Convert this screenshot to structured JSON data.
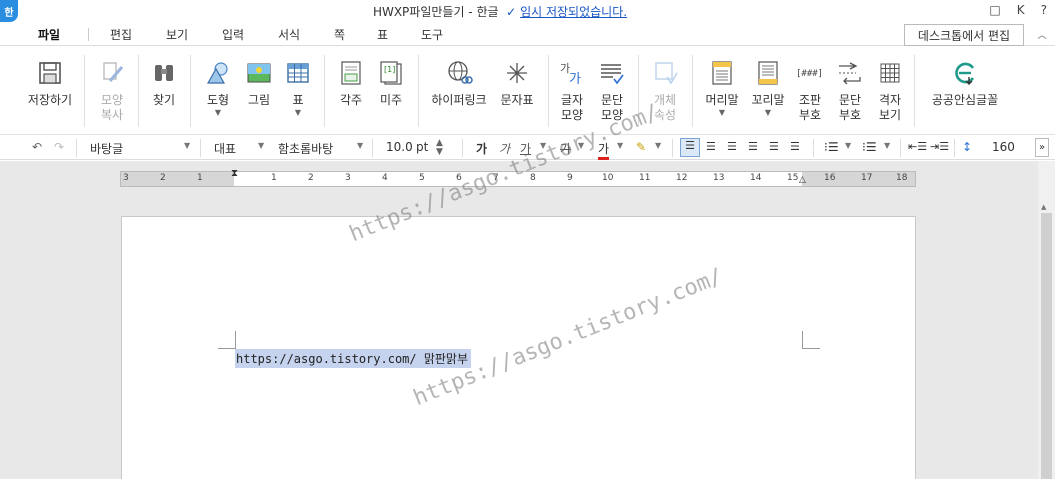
{
  "app": {
    "logo": "한",
    "title": "HWXP파일만들기 - 한글",
    "save_status": "임시 저장되었습니다.",
    "title_icons": {
      "comment": "□",
      "k": "K",
      "help": "?"
    }
  },
  "menu": [
    "파일",
    "편집",
    "보기",
    "입력",
    "서식",
    "쪽",
    "표",
    "도구"
  ],
  "desktop_button": "데스크톱에서 편집",
  "ribbon": {
    "save": "저장하기",
    "shape_copy": [
      "모양",
      "복사"
    ],
    "find": "찾기",
    "shape": "도형",
    "picture": "그림",
    "table": "표",
    "footnote": "각주",
    "endnote": "미주",
    "hyperlink": "하이퍼링크",
    "symbol": "문자표",
    "char_shape": [
      "글자",
      "모양"
    ],
    "para_shape": [
      "문단",
      "모양"
    ],
    "object_props": [
      "개체",
      "속성"
    ],
    "header": "머리말",
    "footer": "꼬리말",
    "layout_num": [
      "조판",
      "부호"
    ],
    "para_num": [
      "문단",
      "부호"
    ],
    "grid": [
      "격자",
      "보기"
    ],
    "public_font": "공공안심글꼴"
  },
  "format": {
    "style": "바탕글",
    "lang": "대표",
    "font": "함초롬바탕",
    "size": "10.0",
    "unit": "pt",
    "bold_label": "가",
    "italic_label": "가",
    "underline_label": "가",
    "strike_label": "가",
    "fontcolor_label": "가",
    "line_spacing": "160"
  },
  "ruler": {
    "numbers": [
      "3",
      "2",
      "1",
      "1",
      "2",
      "3",
      "4",
      "5",
      "6",
      "7",
      "8",
      "9",
      "10",
      "11",
      "12",
      "13",
      "14",
      "15",
      "16",
      "17",
      "18"
    ]
  },
  "document": {
    "text": "https://asgo.tistory.com/ 맑판맑부"
  },
  "watermark": {
    "text": "https://asgo.tistory.com/"
  }
}
